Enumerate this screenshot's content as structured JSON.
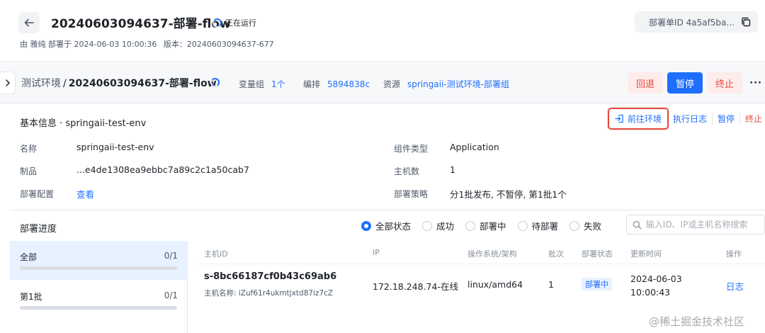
{
  "header": {
    "back_icon": "arrow-left-icon",
    "title": "20240603094637-部署-flow",
    "status_text": "正在运行",
    "meta": {
      "by": "由 雅纯 部署于 2024-06-03 10:00:36",
      "version": "版本：20240603094637-677"
    },
    "deploy_id": "部署单ID 4a5af5ba...",
    "copy_icon": "copy-icon"
  },
  "stage": {
    "env": "测试环境",
    "separator": "/",
    "flow": "20240603094637-部署-flow",
    "var_group_label": "变量组",
    "var_group_value": "1个",
    "orchestration_label": "编排",
    "orchestration_value": "5894838c",
    "resource_label": "资源",
    "resource_value": "springaii-测试环境-部署组",
    "buttons": {
      "rollback": "回退",
      "pause": "暂停",
      "stop": "终止",
      "more": "···"
    }
  },
  "info": {
    "title": "基本信息 · springaii-test-env",
    "actions": {
      "goto_env": "前往环境",
      "exec_log": "执行日志",
      "pause": "暂停",
      "stop": "终止"
    },
    "fields": {
      "name_label": "名称",
      "name_value": "springaii-test-env",
      "artifact_label": "制品",
      "artifact_value": "...e4de1308ea9ebbc7a89c2c1a50cab7",
      "config_label": "部署配置",
      "config_value": "查看",
      "component_type_label": "组件类型",
      "component_type_value": "Application",
      "host_count_label": "主机数",
      "host_count_value": "1",
      "strategy_label": "部署策略",
      "strategy_value": "分1批发布, 不暂停, 第1批1个"
    }
  },
  "progress": {
    "title": "部署进度",
    "filters": [
      "全部状态",
      "成功",
      "部署中",
      "待部署",
      "失败"
    ],
    "selected_filter": "全部状态",
    "search_placeholder": "输入ID、IP或主机名称搜索",
    "batches": [
      {
        "name": "全部",
        "count": "0/1",
        "progress": 0
      },
      {
        "name": "第1批",
        "count": "0/1",
        "progress": 0
      }
    ],
    "columns": [
      "主机ID",
      "IP",
      "操作系统/架构",
      "批次",
      "部署状态",
      "更新时间",
      "操作"
    ],
    "rows": [
      {
        "host_id": "s-8bc66187cf0b43c69ab6",
        "host_name": "主机名称: iZuf61r4ukmtjxtd87iz7cZ",
        "ip": "172.18.248.74-在线",
        "os": "linux/amd64",
        "batch": "1",
        "status": "部署中",
        "updated": "2024-06-03 10:00:43",
        "action": "日志"
      }
    ]
  },
  "watermark": "@稀土掘金技术社区",
  "colors": {
    "primary": "#1f6fff",
    "danger": "#e5483c",
    "highlight_border": "#e5483c"
  }
}
